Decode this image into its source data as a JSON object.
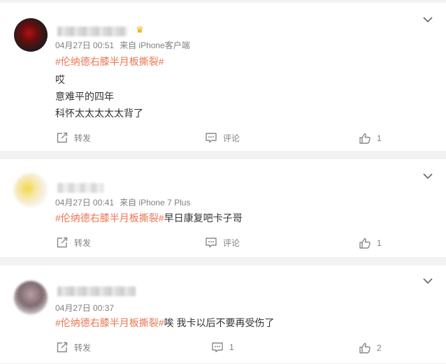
{
  "comments": [
    {
      "meta": {
        "time": "04月27日 00:51",
        "source": "来自 iPhone客户端"
      },
      "lines": [
        {
          "topic": "#伦纳德右膝半月板撕裂#",
          "text": ""
        },
        {
          "topic": "",
          "text": "哎"
        },
        {
          "topic": "",
          "text": "意难平的四年"
        },
        {
          "topic": "",
          "text": "科怀太太太太太背了"
        }
      ],
      "actions": {
        "repost": "转发",
        "comment": "评论",
        "likes": "1"
      }
    },
    {
      "meta": {
        "time": "04月27日 00:41",
        "source": "来自 iPhone 7 Plus"
      },
      "lines": [
        {
          "topic": "#伦纳德右膝半月板撕裂#",
          "text": "早日康复吧卡子哥"
        }
      ],
      "actions": {
        "repost": "转发",
        "comment": "评论",
        "likes": "1"
      }
    },
    {
      "meta": {
        "time": "04月27日 00:37",
        "source": ""
      },
      "lines": [
        {
          "topic": "#伦纳德右膝半月板撕裂#",
          "text": "唉 我卡以后不要再受伤了"
        }
      ],
      "actions": {
        "repost": "转发",
        "comment": "1",
        "likes": "2"
      }
    }
  ],
  "icons": {
    "more": "chevron-down-icon",
    "repost": "share-icon",
    "comment": "comment-icon",
    "like": "thumbs-up-icon",
    "badge": "crown-icon"
  },
  "colors": {
    "topic": "#eb7350",
    "text": "#333333",
    "meta": "#808080",
    "background": "#f2f2f2"
  }
}
